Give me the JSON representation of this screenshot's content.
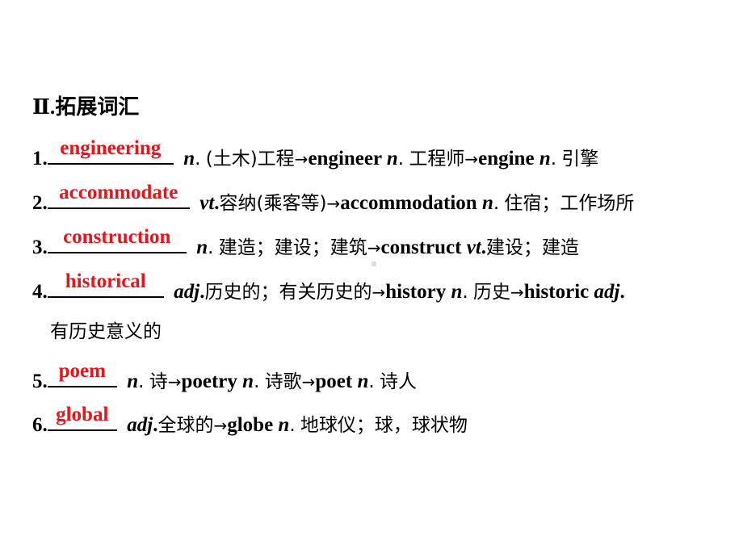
{
  "heading": "Ⅱ.拓展词汇",
  "items": [
    {
      "num": "1.",
      "answer": "engineering",
      "pos1": "n",
      "pos1_sep": ".",
      "meaning1": "(土木)工程",
      "arrow": "→",
      "word2": "engineer",
      "pos2": "n",
      "pos2_sep": ".",
      "meaning2": "工程师",
      "word3": "engine",
      "pos3": "n",
      "pos3_sep": ".",
      "meaning3": "引擎"
    },
    {
      "num": "2.",
      "answer": "accommodate",
      "pos1": "vt",
      "pos1_sep": ".",
      "meaning1": "容纳(乘客等)",
      "arrow": "→",
      "word2": "accommodation",
      "pos2": "n",
      "pos2_sep": ".",
      "meaning2": "住宿；工作场所"
    },
    {
      "num": "3.",
      "answer": "construction",
      "pos1": "n",
      "pos1_sep": ".",
      "meaning1": "建造；建设；建筑",
      "arrow": "→",
      "word2": "construct",
      "pos2": "vt",
      "pos2_sep": ".",
      "meaning2": "建设；建造"
    },
    {
      "num": "4.",
      "answer": "historical",
      "pos1": "adj",
      "pos1_sep": ".",
      "meaning1": "历史的；有关历史的",
      "arrow": "→",
      "word2": "history",
      "pos2": "n",
      "pos2_sep": ".",
      "meaning2": "历史",
      "word3": "historic",
      "pos3": "adj",
      "pos3_sep": ".",
      "meaning3": "有历史意义的"
    },
    {
      "num": "5.",
      "answer": "poem",
      "pos1": "n",
      "pos1_sep": ".",
      "meaning1": "诗",
      "arrow": "→",
      "word2": "poetry",
      "pos2": "n",
      "pos2_sep": ".",
      "meaning2": "诗歌",
      "word3": "poet",
      "pos3": "n",
      "pos3_sep": ".",
      "meaning3": "诗人"
    },
    {
      "num": "6.",
      "answer": "global",
      "pos1": "adj",
      "pos1_sep": ".",
      "meaning1": "全球的",
      "arrow": "→",
      "word2": "globe",
      "pos2": "n",
      "pos2_sep": ".",
      "meaning2": "地球仪；球，球状物"
    }
  ],
  "colors": {
    "answer": "#e8141a",
    "text": "#000000"
  }
}
